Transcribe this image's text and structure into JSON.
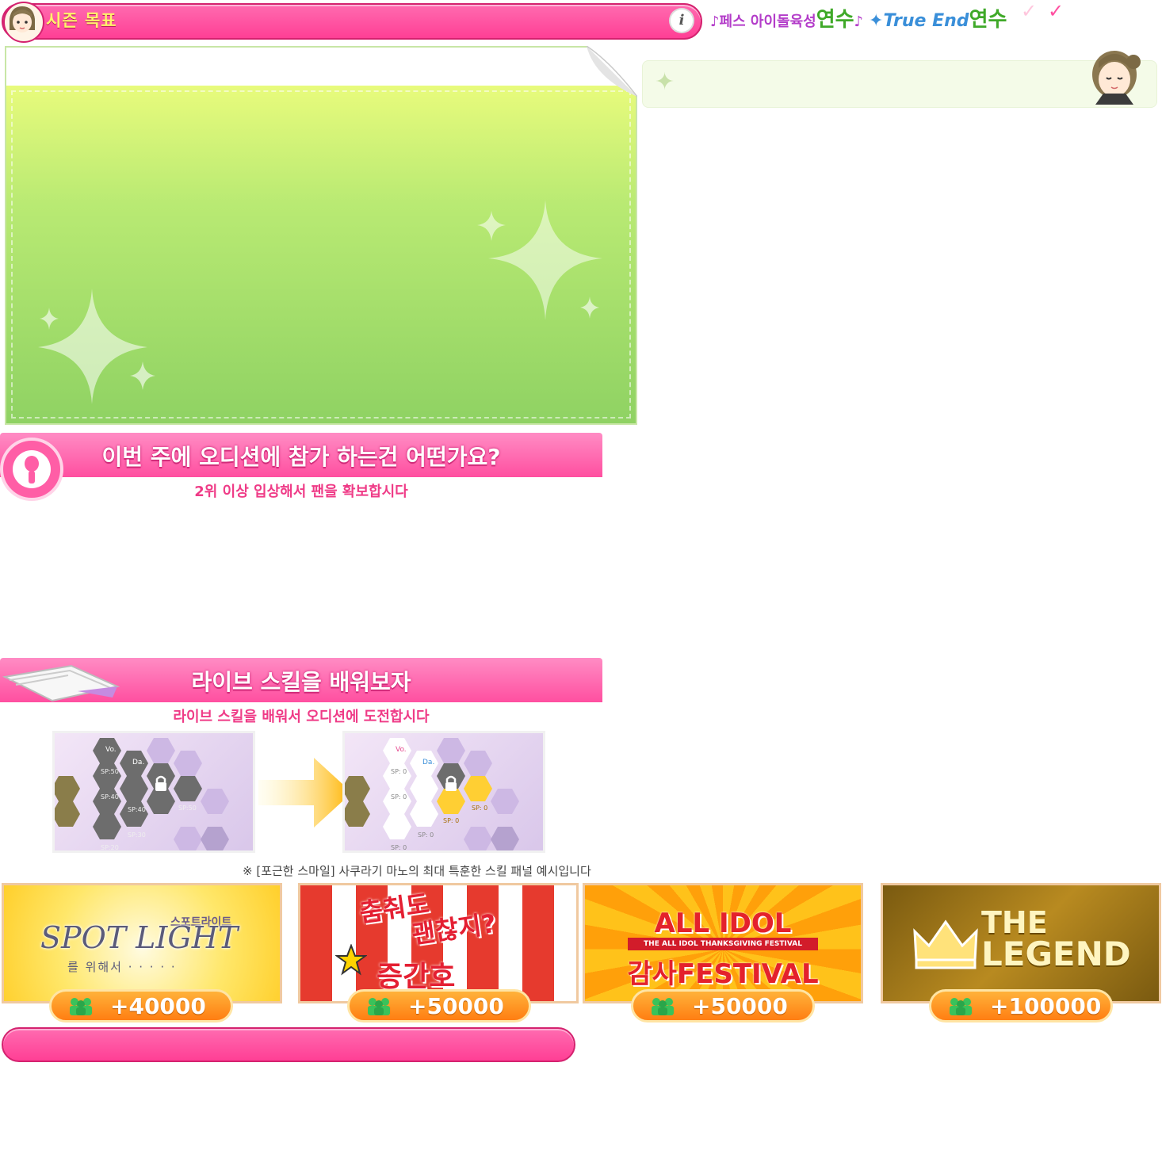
{
  "header": {
    "title": "시즌 목표",
    "info_icon": "i"
  },
  "logos": {
    "fes_prefix": "페스 아이돌육성",
    "fes_suffix": "연수",
    "trueend_prefix": "True End",
    "trueend_suffix": "연수"
  },
  "checks": {
    "first": "✓",
    "second": "✓"
  },
  "audition": {
    "title": "이번 주에 오디션에 참가 하는건 어떤가요?",
    "subtitle": "2위 이상 입상해서 팬을 확보합시다"
  },
  "skill": {
    "title": "라이브 스킬을 배워보자",
    "subtitle": "라이브 스킬을 배워서 오디션에 도전합시다",
    "note": "※ [포근한 스마일] 사쿠라기 마노의 최대 특훈한 스킬 패널 예시입니다",
    "before_labels": [
      "Vo.",
      "Da.",
      "SP:50",
      "SP:50",
      "SP:40",
      "SP:40",
      "SP:30",
      "SP:20"
    ],
    "after_labels": [
      "Vo.",
      "Da.",
      "SP: 0",
      "SP: 0",
      "SP: 0",
      "SP: 0",
      "SP: 0",
      "SP: 0"
    ]
  },
  "events": [
    {
      "name_top": "스포트라이트",
      "name_main": "SPOT LIGHT",
      "name_sub": "를 위해서 · · · · ·",
      "reward": "+40000"
    },
    {
      "name_top": "춤춰도",
      "name_main": "괜찮지?",
      "name_sub": "증간호",
      "reward": "+50000"
    },
    {
      "name_top": "ALL IDOL",
      "name_main": "감사FESTIVAL",
      "name_sub": "THE ALL IDOL THANKSGIVING FESTIVAL",
      "reward": "+50000"
    },
    {
      "name_top": "THE",
      "name_main": "LEGEND",
      "name_sub": "",
      "reward": "+100000"
    }
  ],
  "colors": {
    "accent_pink": "#ff4fa0",
    "title_yellow": "#fff36b",
    "panel_green": "#b9ea73",
    "reward_orange": "#ff7e12"
  }
}
